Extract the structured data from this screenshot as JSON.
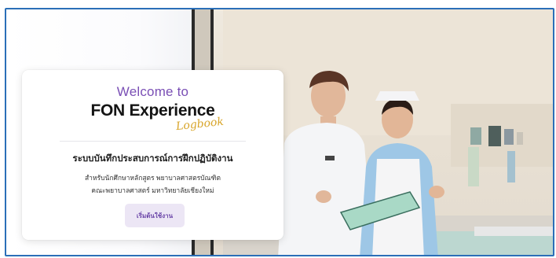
{
  "card": {
    "welcome": "Welcome to",
    "logo_main": "FON Experience",
    "logo_script": "Logbook",
    "heading": "ระบบบันทึกประสบการณ์การฝึกปฏิบัติงาน",
    "sub_line1": "สำหรับนักศึกษาหลักสูตร พยาบาลศาสตรบัณฑิต",
    "sub_line2": "คณะพยาบาลศาสตร์ มหาวิทยาลัยเชียงใหม่",
    "start_button": "เริ่มต้นใช้งาน"
  },
  "colors": {
    "accent": "#7a4fb5",
    "button_bg": "#ece6f5",
    "frame_border": "#2b6fb8"
  },
  "hero_image": "nursing-students-hospital-photo"
}
